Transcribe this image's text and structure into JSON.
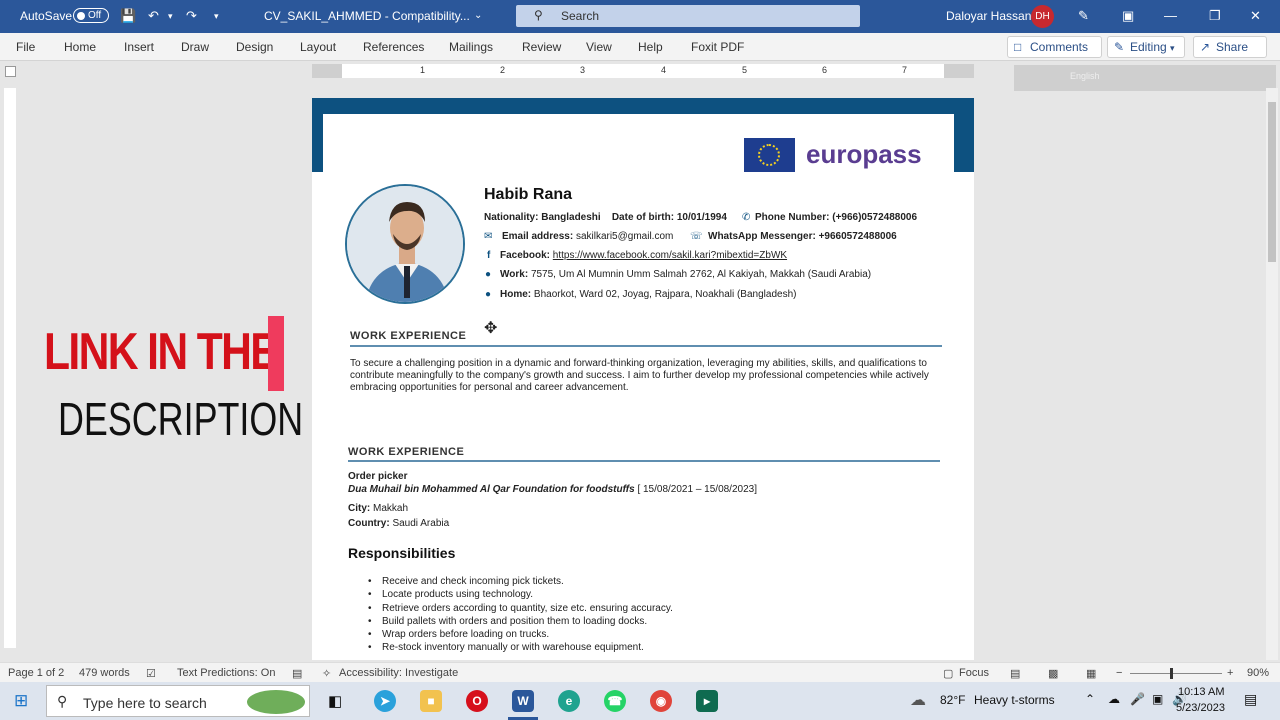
{
  "titlebar": {
    "autosave": "AutoSave",
    "autosave_state": "Off",
    "doc_title": "CV_SAKIL_AHMMED - Compatibility...",
    "search_placeholder": "Search",
    "user_name": "Daloyar Hassan",
    "user_initials": "DH"
  },
  "ribbon": {
    "tabs": [
      "File",
      "Home",
      "Insert",
      "Draw",
      "Design",
      "Layout",
      "References",
      "Mailings",
      "Review",
      "View",
      "Help",
      "Foxit PDF"
    ],
    "comments": "Comments",
    "editing": "Editing",
    "share": "Share"
  },
  "ruler": {
    "numbers": [
      "1",
      "2",
      "3",
      "4",
      "5",
      "6",
      "7"
    ]
  },
  "gray_strip": {
    "label": "English"
  },
  "overlay": {
    "line1": "LINK IN THE",
    "line2": "DESCRIPTION"
  },
  "cv": {
    "brand": "europass",
    "name": "Habib Rana",
    "nationality_label": "Nationality:",
    "nationality": "Bangladeshi",
    "dob_label": "Date of birth:",
    "dob": "10/01/1994",
    "phone_label": "Phone Number:",
    "phone": "(+966)0572488006",
    "email_label": "Email address:",
    "email": "sakilkari5@gmail.com",
    "whatsapp_label": "WhatsApp Messenger:",
    "whatsapp": "+9660572488006",
    "facebook_label": "Facebook:",
    "facebook": "https://www.facebook.com/sakil.kari?mibextid=ZbWK",
    "work_label": "Work:",
    "work_address": "7575, Um Al Mumnin Umm Salmah 2762, Al Kakiyah, Makkah (Saudi Arabia)",
    "home_label": "Home:",
    "home_address": "Bhaorkot, Ward 02, Joyag, Rajpara, Noakhali (Bangladesh)",
    "section1_title": "WORK EXPERIENCE",
    "objective": "To secure a challenging position in a dynamic and forward-thinking organization, leveraging my abilities, skills, and qualifications to contribute meaningfully to the company's growth and success. I aim to further develop my professional competencies while actively embracing opportunities for personal and career advancement.",
    "section2_title": "WORK EXPERIENCE",
    "job_title": "Order picker",
    "employer": "Dua Muhail bin Mohammed Al Qar Foundation for foodstuffs",
    "job_dates": "[ 15/08/2021 – 15/08/2023]",
    "city_label": "City:",
    "city": "Makkah",
    "country_label": "Country:",
    "country": "Saudi Arabia",
    "responsibilities_title": "Responsibilities",
    "responsibilities": [
      "Receive and check incoming pick tickets.",
      "Locate products using technology.",
      "Retrieve orders according to quantity, size etc. ensuring accuracy.",
      "Build pallets with orders and position them to loading docks.",
      "Wrap orders before loading on trucks.",
      "Re-stock inventory manually or with warehouse equipment."
    ]
  },
  "status": {
    "page": "Page 1 of 2",
    "words": "479 words",
    "text_predictions": "Text Predictions: On",
    "accessibility": "Accessibility: Investigate",
    "focus": "Focus",
    "zoom": "90%"
  },
  "taskbar": {
    "search_placeholder": "Type here to search",
    "temperature": "82°F",
    "weather": "Heavy t-storms",
    "time": "10:13 AM",
    "date": "5/23/2023"
  }
}
